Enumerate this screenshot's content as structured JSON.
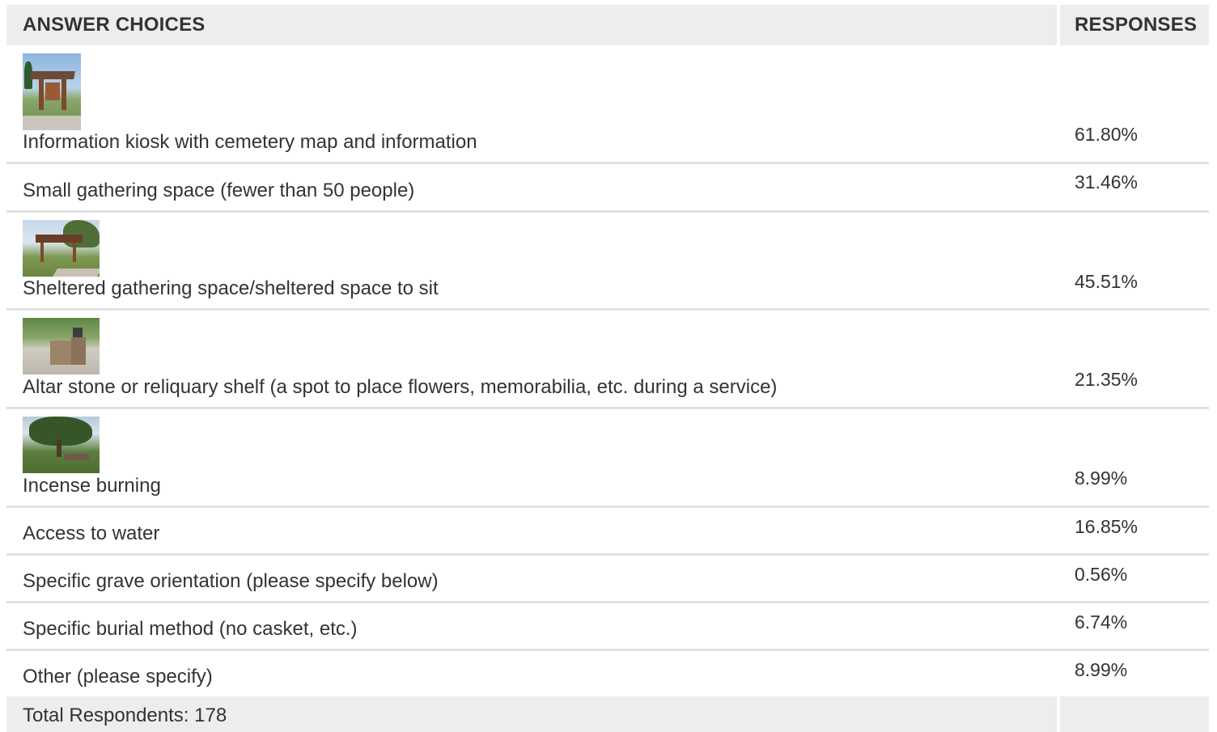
{
  "header": {
    "choices_label": "ANSWER CHOICES",
    "responses_label": "RESPONSES"
  },
  "rows": [
    {
      "label": "Information kiosk with cemetery map and information",
      "response": "61.80%",
      "image": "kiosk-photo"
    },
    {
      "label": "Small gathering space (fewer than 50 people)",
      "response": "31.46%"
    },
    {
      "label": "Sheltered gathering space/sheltered space to sit",
      "response": "45.51%",
      "image": "shelter-photo"
    },
    {
      "label": "Altar stone or reliquary shelf (a spot to place flowers, memorabilia, etc. during a service)",
      "response": "21.35%",
      "image": "altar-photo"
    },
    {
      "label": "Incense burning",
      "response": "8.99%",
      "image": "tree-photo"
    },
    {
      "label": "Access to water",
      "response": "16.85%"
    },
    {
      "label": "Specific grave orientation (please specify below)",
      "response": "0.56%"
    },
    {
      "label": "Specific burial method (no casket, etc.)",
      "response": "6.74%"
    },
    {
      "label": "Other (please specify)",
      "response": "8.99%"
    }
  ],
  "footer": {
    "total_label": "Total Respondents: 178"
  }
}
